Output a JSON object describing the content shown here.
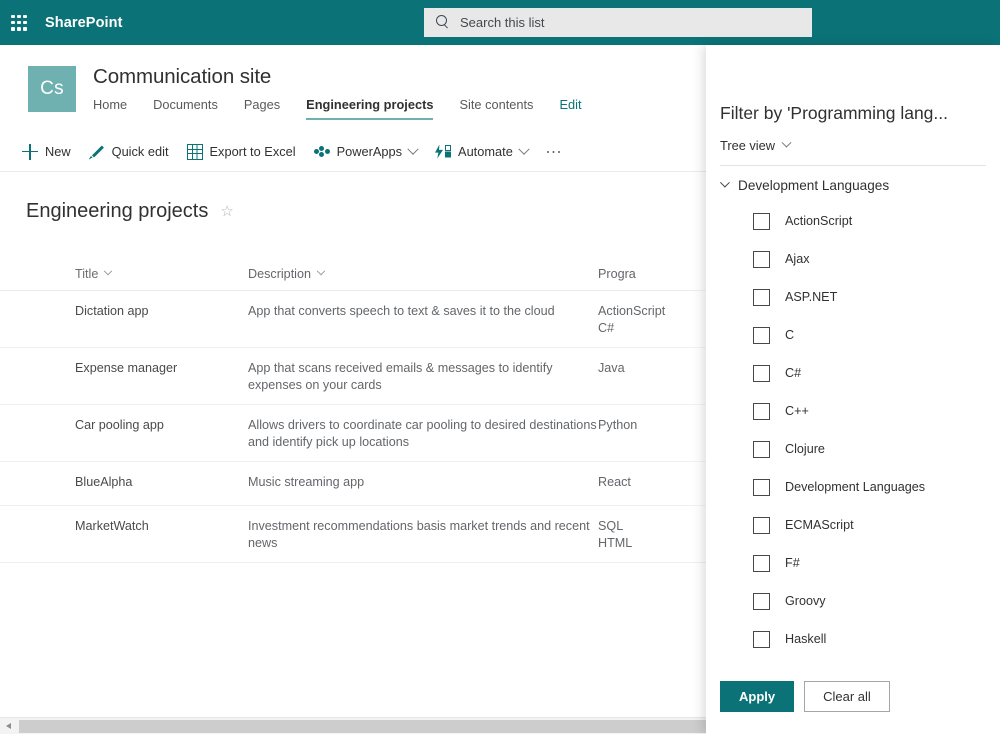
{
  "suite": {
    "waffle_icon": "waffle-grid-icon",
    "title": "SharePoint",
    "search": {
      "icon": "search-icon",
      "placeholder": "Search this list",
      "value": ""
    }
  },
  "site": {
    "logo_initials": "Cs",
    "name": "Communication site",
    "nav": [
      {
        "label": "Home",
        "active": false,
        "edit": false
      },
      {
        "label": "Documents",
        "active": false,
        "edit": false
      },
      {
        "label": "Pages",
        "active": false,
        "edit": false
      },
      {
        "label": "Engineering projects",
        "active": true,
        "edit": false
      },
      {
        "label": "Site contents",
        "active": false,
        "edit": false
      },
      {
        "label": "Edit",
        "active": false,
        "edit": true
      }
    ]
  },
  "commandbar": {
    "items": [
      {
        "label": "New",
        "icon": "plus-icon",
        "chevron": false
      },
      {
        "label": "Quick edit",
        "icon": "pencil-icon",
        "chevron": false
      },
      {
        "label": "Export to Excel",
        "icon": "excel-icon",
        "chevron": false
      },
      {
        "label": "PowerApps",
        "icon": "powerapps-icon",
        "chevron": true
      },
      {
        "label": "Automate",
        "icon": "automate-icon",
        "chevron": true
      }
    ],
    "overflow_icon": "ellipsis-icon"
  },
  "list": {
    "title": "Engineering projects",
    "favorite_icon": "star-outline-icon",
    "columns": [
      {
        "label": "Title",
        "sortable": true
      },
      {
        "label": "Description",
        "sortable": true
      },
      {
        "label": "Progra",
        "sortable": false
      }
    ],
    "rows": [
      {
        "title": "Dictation app",
        "description": "App that converts speech to text & saves it to the cloud",
        "languages": "ActionScript\nC#"
      },
      {
        "title": "Expense manager",
        "description": "App that scans received emails & messages to identify expenses on your cards",
        "languages": "Java"
      },
      {
        "title": "Car pooling app",
        "description": "Allows drivers to coordinate car pooling to desired destinations and identify pick up locations",
        "languages": "Python"
      },
      {
        "title": "BlueAlpha",
        "description": "Music streaming app",
        "languages": "React"
      },
      {
        "title": "MarketWatch",
        "description": "Investment recommendations basis market trends and recent news",
        "languages": "SQL\nHTML"
      }
    ]
  },
  "scrollbar": {
    "left_arrow_icon": "chevron-left-icon"
  },
  "filter_panel": {
    "title": "Filter by 'Programming lang...",
    "view_mode": {
      "label": "Tree view",
      "chevron_icon": "chevron-down-icon"
    },
    "group": {
      "label": "Development Languages",
      "expanded": true,
      "chevron_icon": "chevron-down-icon"
    },
    "options": [
      {
        "label": "ActionScript",
        "checked": false
      },
      {
        "label": "Ajax",
        "checked": false
      },
      {
        "label": "ASP.NET",
        "checked": false
      },
      {
        "label": "C",
        "checked": false
      },
      {
        "label": "C#",
        "checked": false
      },
      {
        "label": "C++",
        "checked": false
      },
      {
        "label": "Clojure",
        "checked": false
      },
      {
        "label": "Development Languages",
        "checked": false
      },
      {
        "label": "ECMAScript",
        "checked": false
      },
      {
        "label": "F#",
        "checked": false
      },
      {
        "label": "Groovy",
        "checked": false
      },
      {
        "label": "Haskell",
        "checked": false
      }
    ],
    "apply_label": "Apply",
    "clear_label": "Clear all"
  },
  "colors": {
    "brand_teal": "#0b7377",
    "logo_teal": "#6fb0b0",
    "search_bg": "#e8e8e8",
    "text_primary": "#323130",
    "text_secondary": "#63666a"
  }
}
